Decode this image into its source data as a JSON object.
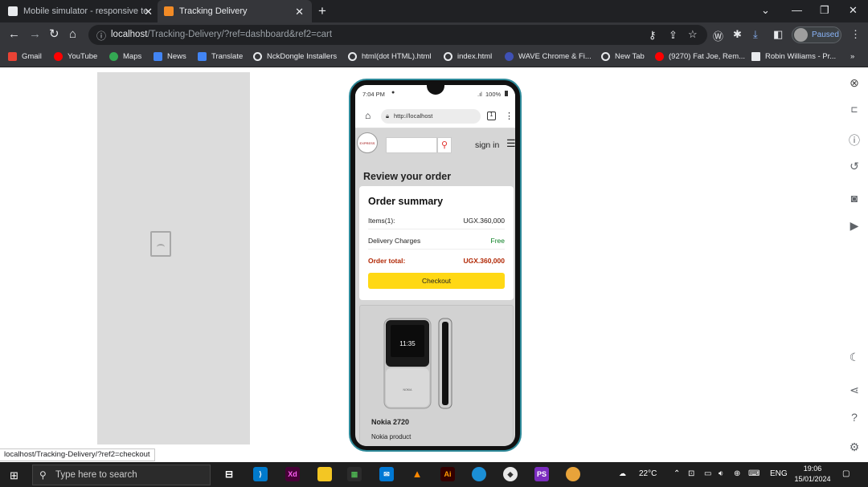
{
  "browser": {
    "tabs": [
      {
        "title": "Mobile simulator - responsive te",
        "active": false
      },
      {
        "title": "Tracking Delivery",
        "active": true
      }
    ],
    "url_host": "localhost",
    "url_path": "/Tracking-Delivery/?ref=dashboard&ref2=cart",
    "profile_status": "Paused",
    "status_bubble": "localhost/Tracking-Delivery/?ref2=checkout",
    "bookmarks": [
      "Gmail",
      "YouTube",
      "Maps",
      "News",
      "Translate",
      "NckDongle Installers",
      "html(dot HTML).html",
      "index.html",
      "WAVE Chrome & Fi...",
      "New Tab",
      "(9270) Fat Joe, Rem...",
      "Robin Williams - Pr..."
    ],
    "bookmarks_more": "»"
  },
  "phone": {
    "status_time": "7:04 PM",
    "battery": "100%",
    "mobile_url": "http://localhost",
    "tab_count": "1",
    "logo_text": "EXPRESS DELIVERY",
    "signin": "sign in",
    "review_heading": "Review your order",
    "summary": {
      "title": "Order summary",
      "items_label": "Items(1):",
      "items_value": "UGX.360,000",
      "delivery_label": "Delivery Charges",
      "delivery_value": "Free",
      "total_label": "Order total:",
      "total_value": "UGX.360,000",
      "checkout_label": "Checkout"
    },
    "product": {
      "screen_time": "11:35",
      "brand": "NOKIA",
      "name": "Nokia 2720",
      "subtitle": "Nokia product"
    }
  },
  "taskbar": {
    "search_placeholder": "Type here to search",
    "weather": "22°C",
    "language": "ENG",
    "time": "19:06",
    "date": "15/01/2024"
  },
  "colors": {
    "chrome_dark": "#202124",
    "chrome_toolbar": "#35363a",
    "checkout_yellow": "#ffd814",
    "order_total_red": "#b12704",
    "free_green": "#067d1f",
    "phone_rim": "#2e8a9a"
  }
}
